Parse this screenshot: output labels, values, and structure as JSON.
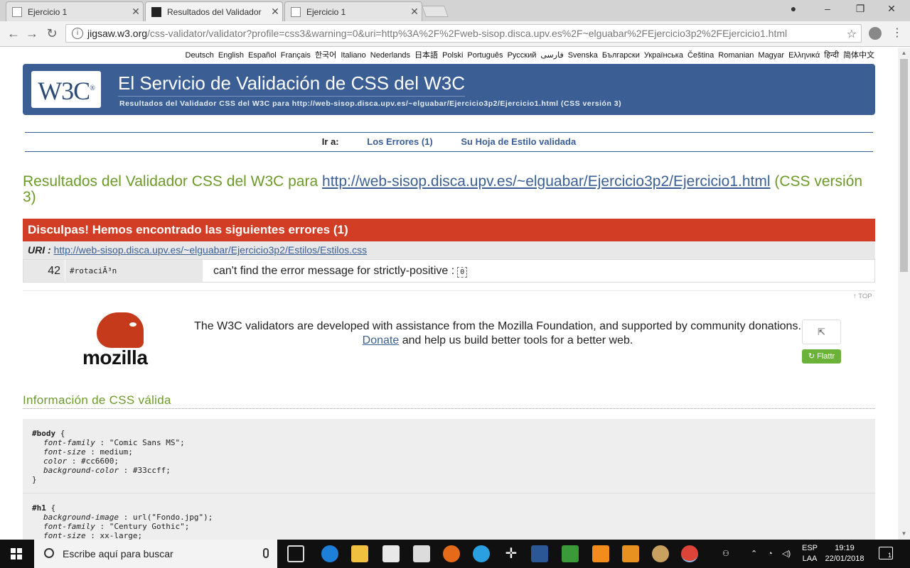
{
  "browser": {
    "tabs": [
      {
        "label": "Ejercicio 1",
        "active": false
      },
      {
        "label": "Resultados del Validador",
        "active": true
      },
      {
        "label": "Ejercicio 1",
        "active": false
      }
    ],
    "url_host": "jigsaw.w3.org",
    "url_path": "/css-validator/validator?profile=css3&warning=0&uri=http%3A%2F%2Fweb-sisop.disca.upv.es%2F~elguabar%2FEjercicio3p2%2FEjercicio1.html"
  },
  "languages": [
    "Deutsch",
    "English",
    "Español",
    "Français",
    "한국어",
    "Italiano",
    "Nederlands",
    "日本語",
    "Polski",
    "Português",
    "Русский",
    "فارسی",
    "Svenska",
    "Български",
    "Українська",
    "Čeština",
    "Romanian",
    "Magyar",
    "Ελληνικά",
    "हिन्दी",
    "简体中文"
  ],
  "banner": {
    "logo_text": "W3C",
    "logo_mark": "®",
    "title": "El Servicio de Validación de CSS del W3C",
    "subtitle": "Resultados del Validador CSS del W3C para http://web-sisop.disca.upv.es/~elguabar/Ejercicio3p2/Ejercicio1.html (CSS versión 3)"
  },
  "goto": {
    "label": "Ir a:",
    "errors_link": "Los Errores (1)",
    "stylesheet_link": "Su Hoja de Estilo validada"
  },
  "results": {
    "title_prefix": "Resultados del Validador CSS del W3C para",
    "title_url": "http://web-sisop.disca.upv.es/~elguabar/Ejercicio3p2/Ejercicio1.html",
    "title_suffix": "(CSS versión 3)"
  },
  "errors": {
    "heading": "Disculpas! Hemos encontrado las siguientes errores (1)",
    "uri_label": "URI :",
    "uri": "http://web-sisop.disca.upv.es/~elguabar/Ejercicio3p2/Estilos/Estilos.css",
    "items": [
      {
        "line": "42",
        "context": "#rotaciÃ³n",
        "message": "can't find the error message for strictly-positive :",
        "code": "0"
      }
    ]
  },
  "top_link": "↑ TOP",
  "mozilla": {
    "wordmark": "mozilla",
    "text_before": "The W3C validators are developed with assistance from the Mozilla Foundation, and supported by community donations.",
    "donate": "Donate",
    "text_after": "and help us build better tools for a better web.",
    "share_icon": "⇱",
    "flattr": "Flattr"
  },
  "valid": {
    "title": "Información de CSS válida",
    "rules": [
      {
        "selector": "#body",
        "props": [
          {
            "name": "font-family",
            "value": "\"Comic Sans MS\";"
          },
          {
            "name": "font-size",
            "value": "medium;"
          },
          {
            "name": "color",
            "value": "#cc6600;"
          },
          {
            "name": "background-color",
            "value": "#33ccff;"
          }
        ]
      },
      {
        "selector": "#h1",
        "props": [
          {
            "name": "background-image",
            "value": "url(\"Fondo.jpg\");"
          },
          {
            "name": "font-family",
            "value": "\"Century Gothic\";"
          },
          {
            "name": "font-size",
            "value": "xx-large;"
          }
        ]
      }
    ]
  },
  "taskbar": {
    "search_placeholder": "Escribe aquí para buscar",
    "lang_line1": "ESP",
    "lang_line2": "LAA",
    "time": "19:19",
    "date": "22/01/2018",
    "notifications": "1"
  },
  "colors": {
    "banner_blue": "#3b5f94",
    "error_red": "#d13d25",
    "title_green": "#6c9a2a"
  }
}
